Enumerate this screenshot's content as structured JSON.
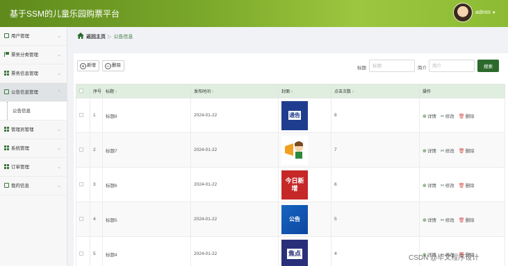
{
  "app": {
    "title": "基于SSM的儿童乐园购票平台"
  },
  "user": {
    "name": "admin"
  },
  "sidebar": {
    "items": [
      {
        "label": "用户管理"
      },
      {
        "label": "票务分类管理"
      },
      {
        "label": "票务信息管理"
      },
      {
        "label": "公告信息管理",
        "sub": "公告信息"
      },
      {
        "label": "管理员管理"
      },
      {
        "label": "系统管理"
      },
      {
        "label": "订单管理"
      },
      {
        "label": "我的信息"
      }
    ]
  },
  "breadcrumb": {
    "home": "返回主页",
    "current": "公告信息"
  },
  "toolbar": {
    "add": "新增",
    "delete": "删除"
  },
  "filters": {
    "title_label": "标题",
    "title_placeholder": "标题",
    "intro_label": "简介",
    "intro_placeholder": "简介",
    "search": "搜索"
  },
  "table": {
    "headers": [
      "",
      "序号",
      "标题",
      "发布时间",
      "封面",
      "点击次数",
      "操作"
    ],
    "actions": {
      "detail": "详情",
      "edit": "修改",
      "delete": "删除"
    },
    "rows": [
      {
        "index": "1",
        "title": "标题8",
        "date": "2024-01-22",
        "clicks": "8",
        "cover": "通告"
      },
      {
        "index": "2",
        "title": "标题7",
        "date": "2024-01-22",
        "clicks": "7",
        "cover": ""
      },
      {
        "index": "3",
        "title": "标题6",
        "date": "2024-01-22",
        "clicks": "6",
        "cover": "今日新增"
      },
      {
        "index": "4",
        "title": "标题5",
        "date": "2024-01-22",
        "clicks": "5",
        "cover": "公告"
      },
      {
        "index": "5",
        "title": "标题4",
        "date": "2024-01-22",
        "clicks": "4",
        "cover": "焦点"
      }
    ]
  },
  "watermark": "CSDN @毕文程序设计",
  "colors": {
    "header": "#7aa82a",
    "accent": "#3c763d",
    "search": "#2b6a2b",
    "table_head": "#dfeede"
  }
}
